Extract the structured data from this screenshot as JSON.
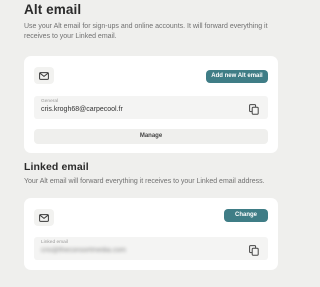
{
  "alt_email": {
    "title": "Alt email",
    "description": "Use your Alt email for sign-ups and online accounts. It will forward everything it receives to your Linked email.",
    "add_button": "Add new Alt email",
    "field_label": "General",
    "field_value": "cris.krogh68@carpecool.fr",
    "manage_button": "Manage"
  },
  "linked_email": {
    "title": "Linked email",
    "description": "Your Alt email will forward everything it receives to your Linked email address.",
    "change_button": "Change",
    "field_label": "Linked email",
    "field_value": "cris@theconsortmedia.com"
  },
  "colors": {
    "accent": "#3f7d86",
    "background": "#efefed",
    "card": "#ffffff"
  },
  "icons": [
    "mail-icon",
    "copy-icon"
  ]
}
